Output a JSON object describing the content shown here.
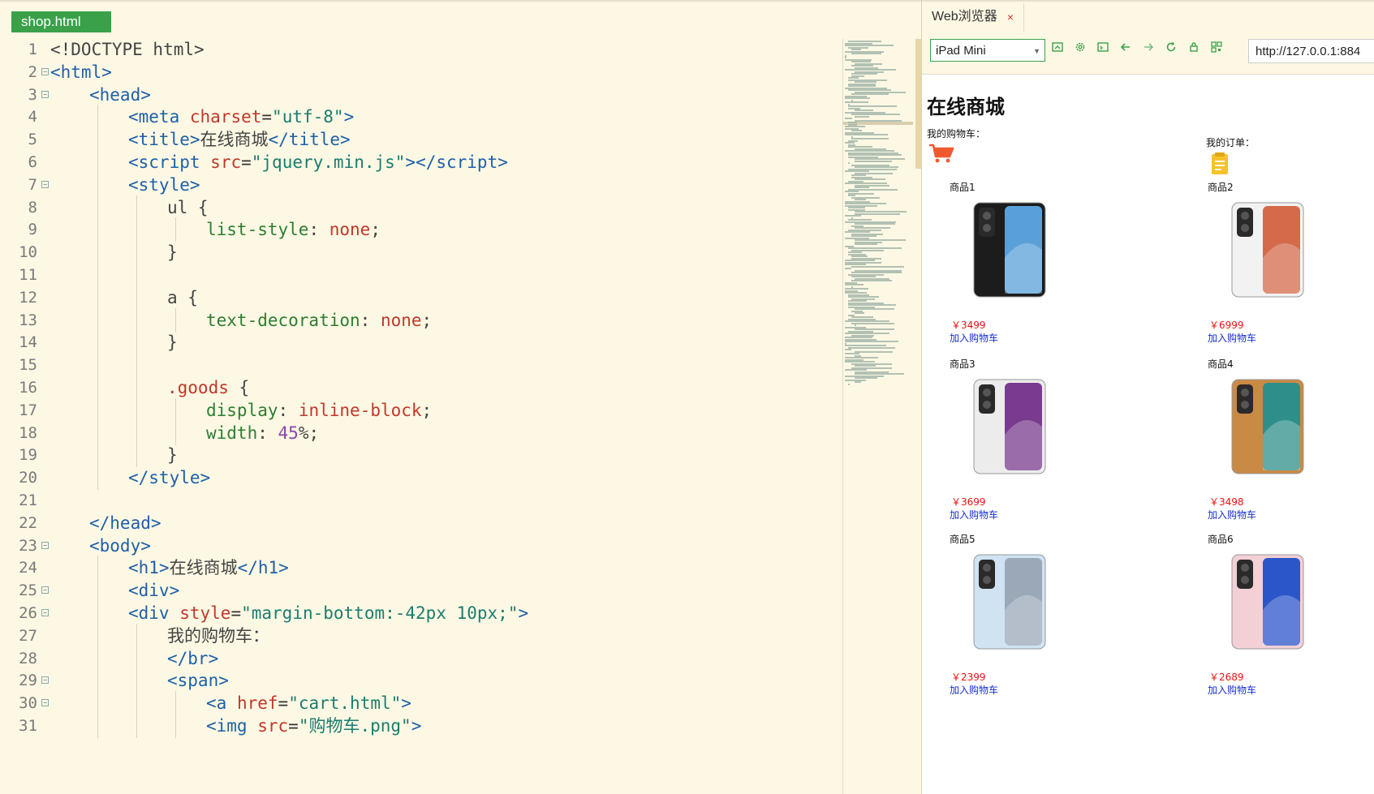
{
  "editor": {
    "active_tab": "shop.html",
    "lines": [
      {
        "n": "1",
        "fold": false,
        "indent": 0,
        "html": "<span class=\"tx\">&lt;!DOCTYPE html&gt;</span>"
      },
      {
        "n": "2",
        "fold": true,
        "indent": 0,
        "html": "<span class=\"tg\">&lt;html&gt;</span>"
      },
      {
        "n": "3",
        "fold": true,
        "indent": 1,
        "html": "<span class=\"tg\">&lt;head&gt;</span>"
      },
      {
        "n": "4",
        "fold": false,
        "indent": 2,
        "html": "<span class=\"tg\">&lt;meta</span> <span class=\"at\">charset</span>=<span class=\"st\">\"utf-8\"</span><span class=\"tg\">&gt;</span>"
      },
      {
        "n": "5",
        "fold": false,
        "indent": 2,
        "html": "<span class=\"tg\">&lt;title&gt;</span><span class=\"tx\">在线商城</span><span class=\"tg\">&lt;/title&gt;</span>"
      },
      {
        "n": "6",
        "fold": false,
        "indent": 2,
        "html": "<span class=\"tg\">&lt;script</span> <span class=\"at\">src</span>=<span class=\"st\">\"jquery.min.js\"</span><span class=\"tg\">&gt;&lt;/script&gt;</span>"
      },
      {
        "n": "7",
        "fold": true,
        "indent": 2,
        "html": "<span class=\"tg\">&lt;style&gt;</span>"
      },
      {
        "n": "8",
        "fold": false,
        "indent": 3,
        "html": "<span class=\"tx\">ul {</span>"
      },
      {
        "n": "9",
        "fold": false,
        "indent": 4,
        "html": "<span class=\"pr\">list-style</span><span class=\"tx\">: </span><span class=\"vl\">none</span><span class=\"tx\">;</span>"
      },
      {
        "n": "10",
        "fold": false,
        "indent": 3,
        "html": "<span class=\"tx\">}</span>"
      },
      {
        "n": "11",
        "fold": false,
        "indent": 3,
        "html": ""
      },
      {
        "n": "12",
        "fold": false,
        "indent": 3,
        "html": "<span class=\"tx\">a {</span>"
      },
      {
        "n": "13",
        "fold": false,
        "indent": 4,
        "html": "<span class=\"pr\">text-decoration</span><span class=\"tx\">: </span><span class=\"vl\">none</span><span class=\"tx\">;</span>"
      },
      {
        "n": "14",
        "fold": false,
        "indent": 3,
        "html": "<span class=\"tx\">}</span>"
      },
      {
        "n": "15",
        "fold": false,
        "indent": 3,
        "html": ""
      },
      {
        "n": "16",
        "fold": false,
        "indent": 3,
        "html": "<span class=\"sl\">.goods</span> <span class=\"tx\">{</span>"
      },
      {
        "n": "17",
        "fold": false,
        "indent": 4,
        "html": "<span class=\"pr\">display</span><span class=\"tx\">: </span><span class=\"vl\">inline-block</span><span class=\"tx\">;</span>"
      },
      {
        "n": "18",
        "fold": false,
        "indent": 4,
        "html": "<span class=\"pr\">width</span><span class=\"tx\">: </span><span class=\"nm\">45</span><span class=\"tx\">%;</span>"
      },
      {
        "n": "19",
        "fold": false,
        "indent": 3,
        "html": "<span class=\"tx\">}</span>"
      },
      {
        "n": "20",
        "fold": false,
        "indent": 2,
        "html": "<span class=\"tg\">&lt;/style&gt;</span>"
      },
      {
        "n": "21",
        "fold": false,
        "indent": 1,
        "html": ""
      },
      {
        "n": "22",
        "fold": false,
        "indent": 1,
        "html": "<span class=\"tg\">&lt;/head&gt;</span>"
      },
      {
        "n": "23",
        "fold": true,
        "indent": 1,
        "html": "<span class=\"tg\">&lt;body&gt;</span>"
      },
      {
        "n": "24",
        "fold": false,
        "indent": 2,
        "html": "<span class=\"tg\">&lt;h1&gt;</span><span class=\"tx\">在线商城</span><span class=\"tg\">&lt;/h1&gt;</span>"
      },
      {
        "n": "25",
        "fold": true,
        "indent": 2,
        "html": "<span class=\"tg\">&lt;div&gt;</span>"
      },
      {
        "n": "26",
        "fold": true,
        "indent": 2,
        "html": "<span class=\"tg\">&lt;div</span> <span class=\"at\">style</span>=<span class=\"st\">\"margin-bottom:-42px 10px;\"</span><span class=\"tg\">&gt;</span>"
      },
      {
        "n": "27",
        "fold": false,
        "indent": 3,
        "html": "<span class=\"tx\">我的购物车：</span>"
      },
      {
        "n": "28",
        "fold": false,
        "indent": 3,
        "html": "<span class=\"tg\">&lt;/br&gt;</span>"
      },
      {
        "n": "29",
        "fold": true,
        "indent": 3,
        "html": "<span class=\"tg\">&lt;span&gt;</span>"
      },
      {
        "n": "30",
        "fold": true,
        "indent": 4,
        "html": "<span class=\"tg\">&lt;a</span> <span class=\"at\">href</span>=<span class=\"st\">\"cart.html\"</span><span class=\"tg\">&gt;</span>"
      },
      {
        "n": "31",
        "fold": false,
        "indent": 4,
        "html": "<span class=\"tg\">&lt;img</span> <span class=\"at\">src</span>=<span class=\"st\">\"购物车.png\"</span><span class=\"tg\">&gt;</span>"
      }
    ]
  },
  "browser": {
    "tab_label": "Web浏览器",
    "tab_close": "×",
    "device": "iPad Mini",
    "url": "http://127.0.0.1:884",
    "page": {
      "title": "在线商城",
      "cart_label": "我的购物车：",
      "order_label": "我的订单：",
      "goods": [
        {
          "name": "商品1",
          "price": "￥3499",
          "add": "加入购物车",
          "phone_color": "#1c1c1c",
          "screen": "#5aa0d8"
        },
        {
          "name": "商品2",
          "price": "￥6999",
          "add": "加入购物车",
          "phone_color": "#f2f2f2",
          "screen": "#d46a4a"
        },
        {
          "name": "商品3",
          "price": "￥3699",
          "add": "加入购物车",
          "phone_color": "#ececec",
          "screen": "#7a3b8e"
        },
        {
          "name": "商品4",
          "price": "￥3498",
          "add": "加入购物车",
          "phone_color": "#c98a45",
          "screen": "#2e8f8a"
        },
        {
          "name": "商品5",
          "price": "￥2399",
          "add": "加入购物车",
          "phone_color": "#cfe3f2",
          "screen": "#9aa8b8"
        },
        {
          "name": "商品6",
          "price": "￥2689",
          "add": "加入购物车",
          "phone_color": "#f3cfd6",
          "screen": "#2a56c9"
        }
      ]
    }
  }
}
